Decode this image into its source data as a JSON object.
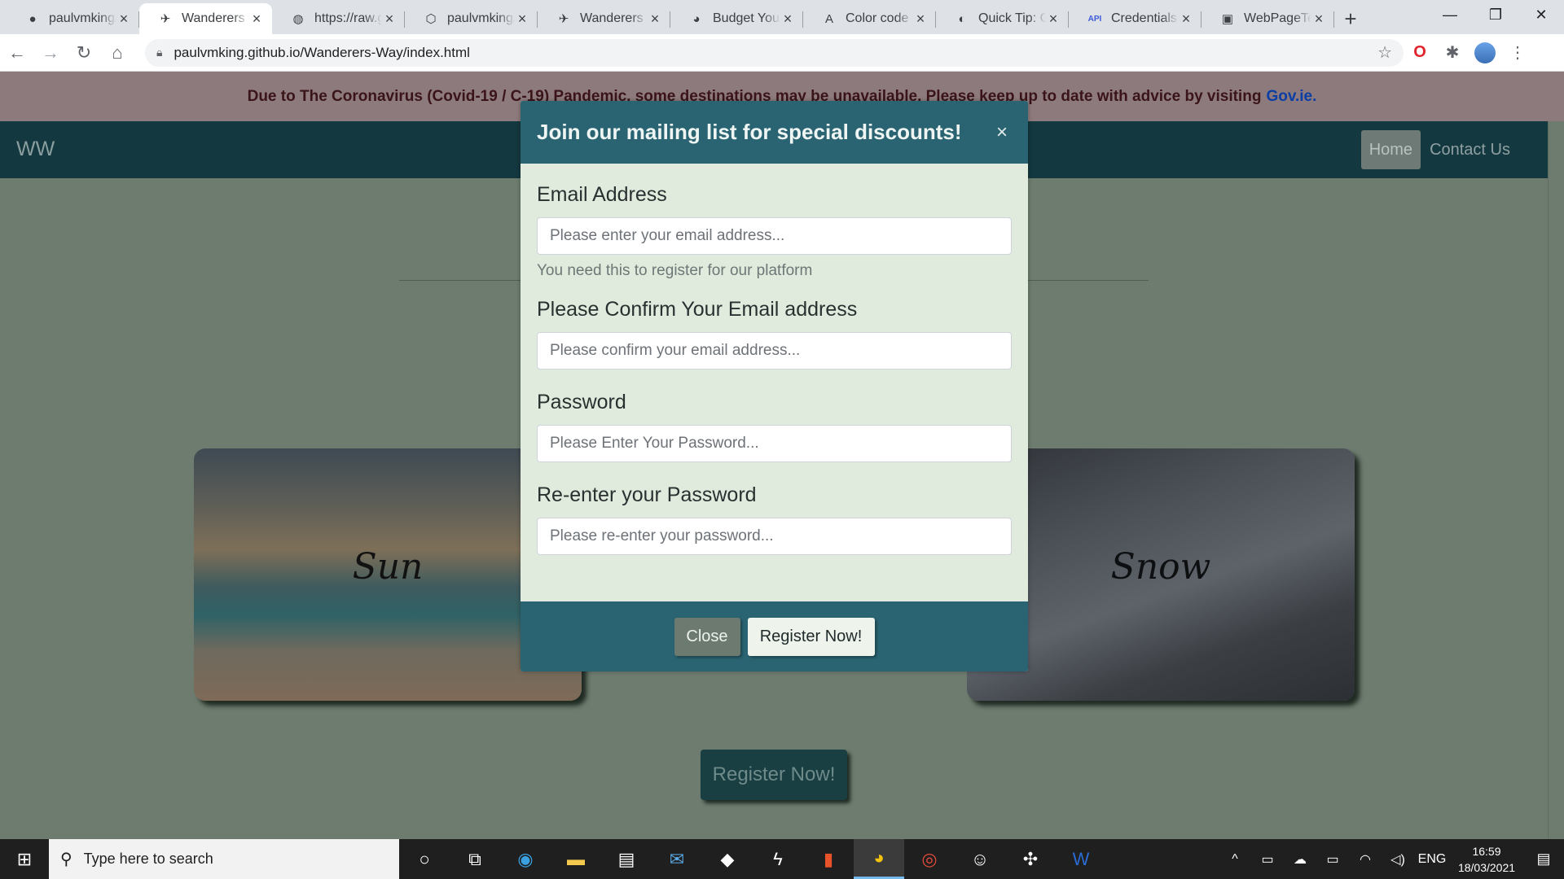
{
  "browser": {
    "tabs": [
      {
        "icon": "github-icon",
        "glyph": "●",
        "title": "paulvmking/"
      },
      {
        "icon": "plane-icon",
        "glyph": "✈",
        "title": "Wanderers W",
        "active": true
      },
      {
        "icon": "globe-icon",
        "glyph": "◍",
        "title": "https://raw.g"
      },
      {
        "icon": "shield-icon",
        "glyph": "⬡",
        "title": "paulvmking/"
      },
      {
        "icon": "plane-icon",
        "glyph": "✈",
        "title": "Wanderers W"
      },
      {
        "icon": "budget-icon",
        "glyph": "◕",
        "title": "Budget Your"
      },
      {
        "icon": "color-code-icon",
        "glyph": "A",
        "title": "Color code f"
      },
      {
        "icon": "quicktip-icon",
        "glyph": "◐",
        "title": "Quick Tip: G"
      },
      {
        "icon": "api-icon",
        "glyph": "API",
        "title": "Credentials"
      },
      {
        "icon": "webpagetest-icon",
        "glyph": "▣",
        "title": "WebPageTes"
      }
    ],
    "url": "paulvmking.github.io/Wanderers-Way/index.html"
  },
  "page": {
    "alert_text": "Due to The Coronavirus (Covid-19 / C-19) Pandemic, some destinations may be unavailable. Please keep up to date with advice by visiting",
    "alert_link": "Gov.ie.",
    "brand": "WW",
    "nav": {
      "home": "Home",
      "contact": "Contact Us"
    },
    "cards": {
      "sun": "Sun",
      "snow": "Snow"
    },
    "register_button": "Register Now!"
  },
  "modal": {
    "title": "Join our mailing list for special discounts!",
    "close_glyph": "×",
    "fields": {
      "email_label": "Email Address",
      "email_placeholder": "Please enter your email address...",
      "email_help": "You need this to register for our platform",
      "confirm_label": "Please Confirm Your Email address",
      "confirm_placeholder": "Please confirm your email address...",
      "password_label": "Password",
      "password_placeholder": "Please Enter Your Password...",
      "repassword_label": "Re-enter your Password",
      "repassword_placeholder": "Please re-enter your password..."
    },
    "close_button": "Close",
    "register_button": "Register Now!"
  },
  "taskbar": {
    "search_placeholder": "Type here to search",
    "language": "ENG",
    "time": "16:59",
    "date": "18/03/2021"
  },
  "colors": {
    "modal_header": "#2a6472",
    "modal_body": "#e0ebdd",
    "navbar": "#14383f",
    "alert": "#8d7a7d"
  }
}
